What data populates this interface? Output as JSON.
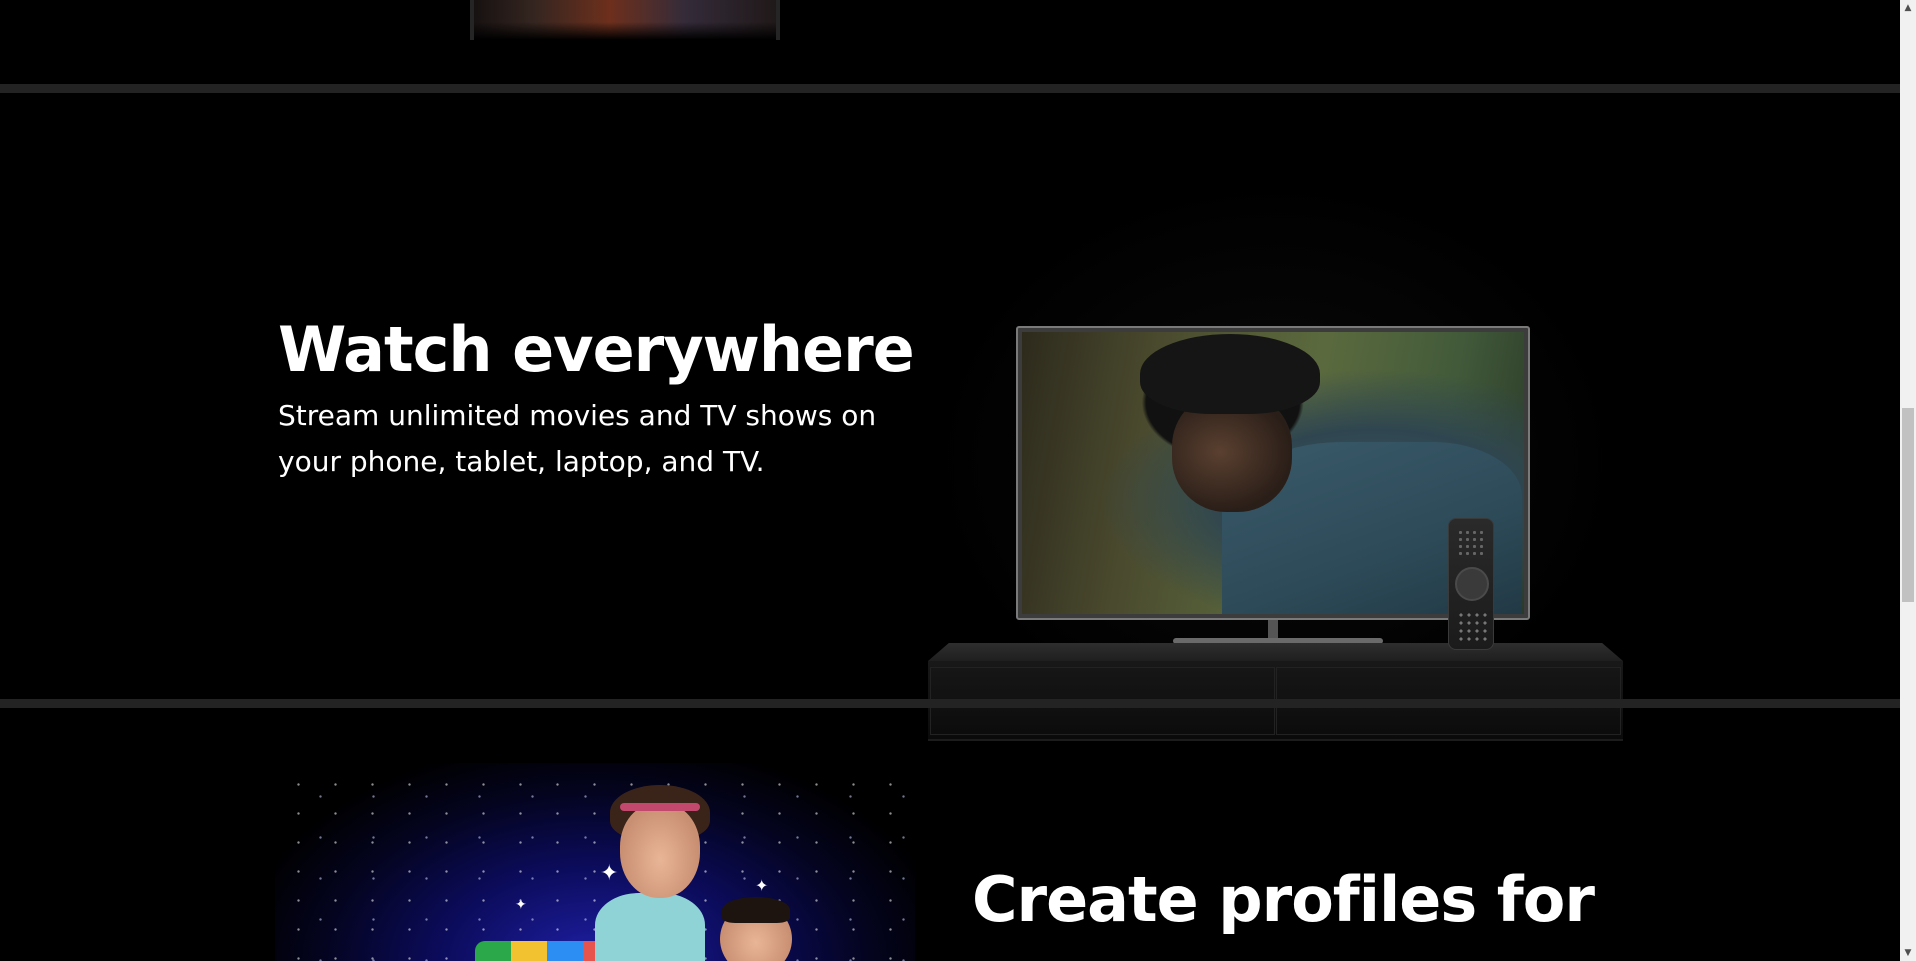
{
  "sections": {
    "watch": {
      "title": "Watch everywhere",
      "subtitle": "Stream unlimited movies and TV shows on your phone, tablet, laptop, and TV."
    },
    "profiles": {
      "title": "Create profiles for"
    }
  },
  "icons": {
    "scroll_up": "scroll-up-arrow-icon",
    "scroll_down": "scroll-down-arrow-icon"
  },
  "colors": {
    "background": "#000000",
    "divider": "#232323",
    "text": "#ffffff",
    "scrollbar_track": "#f1f1f1",
    "scrollbar_thumb": "#c1c1c1"
  },
  "scrollbar": {
    "position_fraction": 0.52
  }
}
